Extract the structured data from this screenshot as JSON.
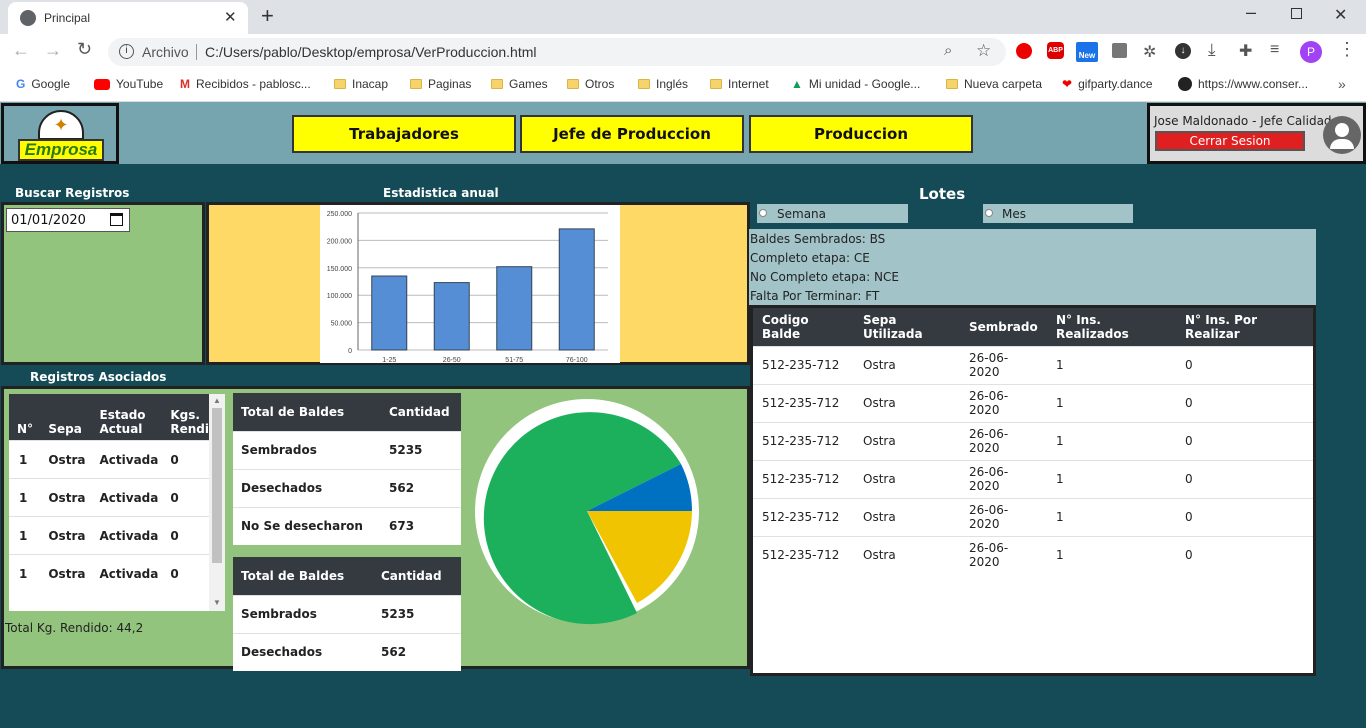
{
  "browser": {
    "tab_title": "Principal",
    "url_prefix": "Archivo",
    "url": "C:/Users/pablo/Desktop/emprosa/VerProduccion.html",
    "profile_initial": "P",
    "ext_badge": "New",
    "bookmarks": [
      "Google",
      "YouTube",
      "Recibidos - pablosc...",
      "Inacap",
      "Paginas",
      "Games",
      "Otros",
      "Inglés",
      "Internet",
      "Mi unidad - Google...",
      "Nueva carpeta",
      "gifparty.dance",
      "https://www.conser..."
    ]
  },
  "app": {
    "logo_text": "Emprosa",
    "nav": [
      "Trabajadores",
      "Jefe de Produccion",
      "Produccion"
    ],
    "user_name": "Jose Maldonado - Jefe Calidad",
    "logout_label": "Cerrar Sesion"
  },
  "search": {
    "title": "Buscar Registros",
    "date_value": "01/01/2020"
  },
  "chart_title": "Estadistica anual",
  "chart_data": {
    "type": "bar",
    "categories": [
      "1-25",
      "26-50",
      "51-75",
      "76-100"
    ],
    "values": [
      135000,
      123000,
      152000,
      221000
    ],
    "ylim": [
      0,
      250000
    ],
    "yticks": [
      "250.000",
      "200.000",
      "150.000",
      "100.000",
      "50.000",
      "0"
    ],
    "color": "#558ed5"
  },
  "registros": {
    "title": "Registros Asociados",
    "headers": [
      "N°",
      "Sepa",
      "Estado Actual",
      "Kgs. Rendi"
    ],
    "rows": [
      [
        "1",
        "Ostra",
        "Activada",
        "0"
      ],
      [
        "1",
        "Ostra",
        "Activada",
        "0"
      ],
      [
        "1",
        "Ostra",
        "Activada",
        "0"
      ],
      [
        "1",
        "Ostra",
        "Activada",
        "0"
      ]
    ],
    "total": "Total Kg. Rendido: 44,2"
  },
  "baldes1": {
    "headers": [
      "Total de Baldes",
      "Cantidad"
    ],
    "rows": [
      [
        "Sembrados",
        "5235"
      ],
      [
        "Desechados",
        "562"
      ],
      [
        "No Se desecharon",
        "673"
      ]
    ]
  },
  "baldes2": {
    "headers": [
      "Total de Baldes",
      "Cantidad"
    ],
    "rows": [
      [
        "Sembrados",
        "5235"
      ],
      [
        "Desechados",
        "562"
      ]
    ]
  },
  "pie": {
    "colors": [
      "#1caf5c",
      "#0070c0",
      "#f0c400"
    ]
  },
  "lotes": {
    "title": "Lotes",
    "options": [
      "Semana",
      "Mes"
    ],
    "legend": [
      "Baldes Sembrados: BS",
      "Completo etapa: CE",
      "No Completo etapa: NCE",
      "Falta Por Terminar: FT"
    ],
    "headers": [
      "Codigo Balde",
      "Sepa Utilizada",
      "Sembrado",
      "N° Ins. Realizados",
      "N° Ins. Por Realizar"
    ],
    "rows": [
      [
        "512-235-712",
        "Ostra",
        "26-06-2020",
        "1",
        "0"
      ],
      [
        "512-235-712",
        "Ostra",
        "26-06-2020",
        "1",
        "0"
      ],
      [
        "512-235-712",
        "Ostra",
        "26-06-2020",
        "1",
        "0"
      ],
      [
        "512-235-712",
        "Ostra",
        "26-06-2020",
        "1",
        "0"
      ],
      [
        "512-235-712",
        "Ostra",
        "26-06-2020",
        "1",
        "0"
      ],
      [
        "512-235-712",
        "Ostra",
        "26-06-2020",
        "1",
        "0"
      ]
    ]
  }
}
